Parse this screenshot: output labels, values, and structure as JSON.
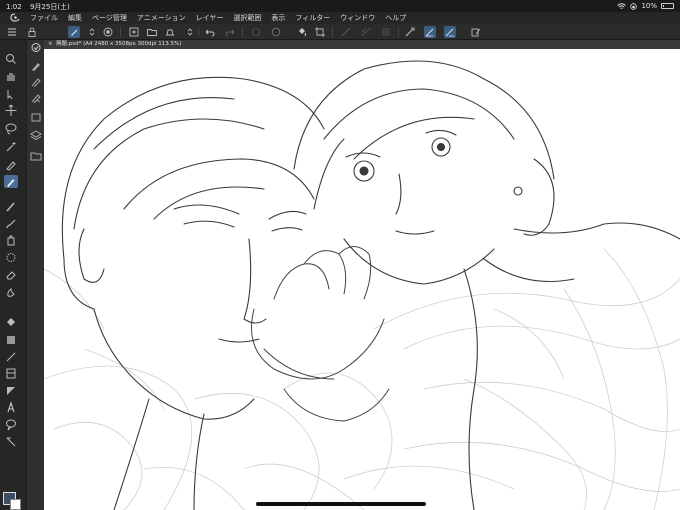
{
  "status_bar": {
    "time": "1:02",
    "date": "9月25日(土)",
    "battery_text": "10%",
    "battery_level": 0.1
  },
  "menu": {
    "items": [
      "ファイル",
      "編集",
      "ページ管理",
      "アニメーション",
      "レイヤー",
      "選択範囲",
      "表示",
      "フィルター",
      "ウィンドウ",
      "ヘルプ"
    ]
  },
  "document": {
    "close_glyph": "×",
    "title": "無題.psd* (A4 2480 x 3508px 300dpi 113.5%)"
  },
  "colors": {
    "main_color": "#3d4f63",
    "sub_color": "#ffffff",
    "accent": "#4a6f96"
  },
  "icons": {
    "app": "clip-studio-logo",
    "wifi": "wifi-icon",
    "battery": "battery-icon"
  }
}
